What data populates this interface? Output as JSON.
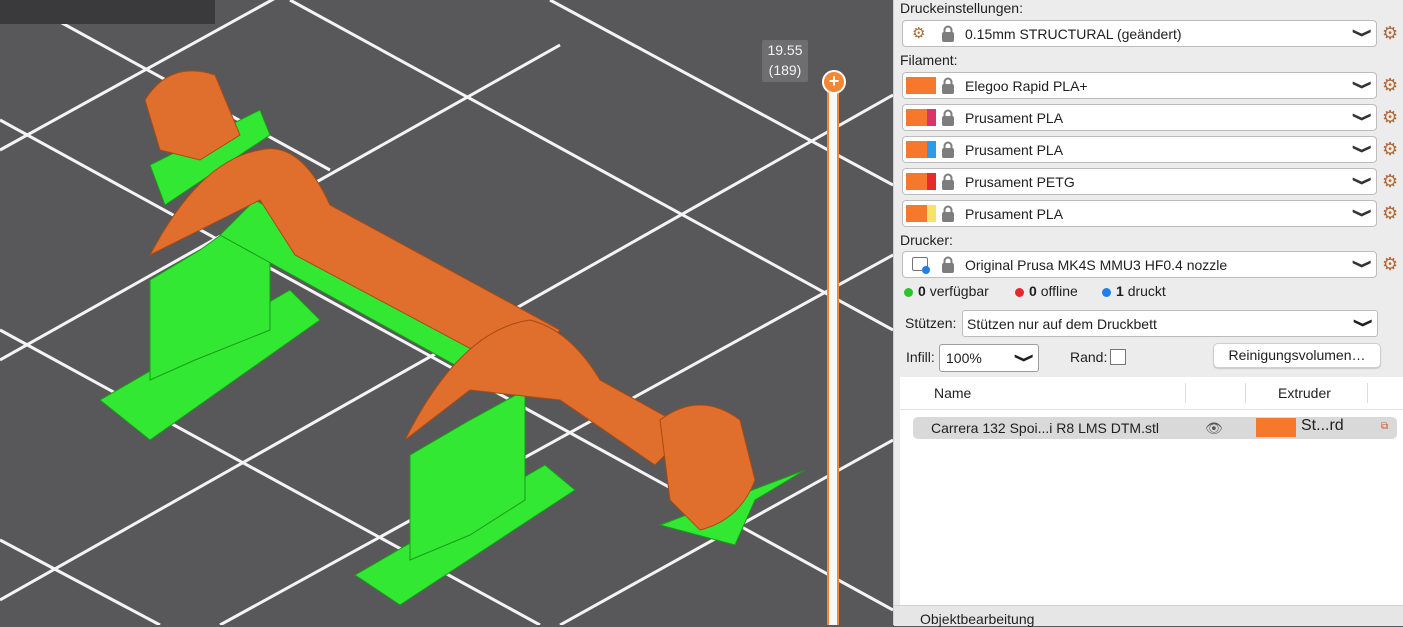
{
  "viewport": {
    "layer_height": "19.55",
    "layer_index": "(189)",
    "colors": {
      "model": "#e06e2d",
      "support": "#33e833",
      "bed": "#58585a",
      "grid": "#ffffff",
      "slider": "#f58634"
    }
  },
  "panel": {
    "print_settings_label": "Druckeinstellungen:",
    "print_profile": "0.15mm STRUCTURAL (geändert)",
    "filament_label": "Filament:",
    "filaments": [
      {
        "name": "Elegoo Rapid PLA+",
        "color": "#f5782c",
        "color2": ""
      },
      {
        "name": "Prusament PLA",
        "color": "#f5782c",
        "color2": "#d8356b"
      },
      {
        "name": "Prusament PLA",
        "color": "#f5782c",
        "color2": "#2d9be8"
      },
      {
        "name": "Prusament PETG",
        "color": "#f5782c",
        "color2": "#e52b2b"
      },
      {
        "name": "Prusament PLA",
        "color": "#f5782c",
        "color2": "#f7e36a"
      }
    ],
    "printer_label": "Drucker:",
    "printer": "Original Prusa MK4S MMU3 HF0.4 nozzle",
    "status": [
      {
        "count": "0",
        "label": "verfügbar",
        "color": "#2ec22e"
      },
      {
        "count": "0",
        "label": "offline",
        "color": "#e8262c"
      },
      {
        "count": "1",
        "label": "druckt",
        "color": "#1e7fe8"
      }
    ],
    "supports_label": "Stützen:",
    "supports_value": "Stützen nur auf dem Druckbett",
    "infill_label": "Infill:",
    "infill_value": "100%",
    "brim_label": "Rand:",
    "purge_button": "Reinigungsvolumen…",
    "list": {
      "col_name": "Name",
      "col_extruder": "Extruder",
      "rows": [
        {
          "name": "Carrera 132 Spoi...i R8 LMS DTM.stl",
          "extruder": "St...rd"
        }
      ]
    },
    "bottom_tab": "Objektbearbeitung"
  }
}
